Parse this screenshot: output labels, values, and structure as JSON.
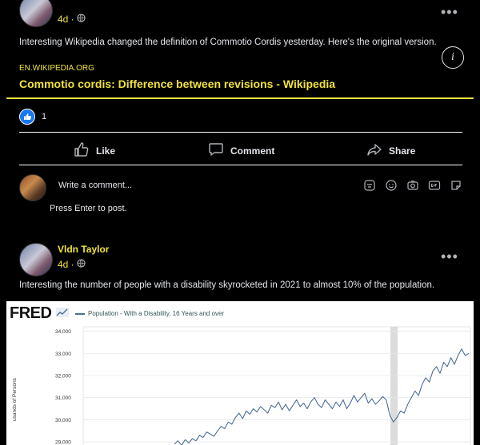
{
  "post1": {
    "time": "4d ·",
    "menu": "•••",
    "text": "Interesting Wikipedia changed the definition of Commotio Cordis yesterday. Here's the original version.",
    "link_domain": "EN.WIKIPEDIA.ORG",
    "link_title": "Commotio cordis: Difference between revisions - Wikipedia",
    "info_glyph": "i",
    "like_count": "1",
    "actions": {
      "like": "Like",
      "comment": "Comment",
      "share": "Share"
    },
    "comment_placeholder": "Write a comment...",
    "comment_hint": "Press Enter to post.",
    "comment_tools": [
      "sticker-icon",
      "emoji-icon",
      "camera-icon",
      "gif-icon",
      "avatar-sticker-icon"
    ]
  },
  "post2": {
    "author": "Vldn Taylor",
    "time": "4d ·",
    "menu": "•••",
    "text": "Interesting the number of people with a disability skyrocketed in 2021 to almost 10% of the population."
  },
  "colors": {
    "accent": "#f1e33a",
    "background": "#000000",
    "like_blue": "#1877f2",
    "chart_line": "#4d6e95"
  },
  "chart_data": {
    "type": "line",
    "logo": "FRED",
    "series": [
      {
        "name": "Population - With a Disability, 16 Years and over",
        "values": [
          28900,
          29050,
          28850,
          29100,
          28950,
          29150,
          29050,
          29300,
          29200,
          29450,
          29350,
          29250,
          29500,
          29700,
          29600,
          29900,
          29800,
          30100,
          30300,
          30050,
          30400,
          30250,
          30500,
          30350,
          30600,
          30450,
          30300,
          30650,
          30550,
          30800,
          30450,
          30700,
          30400,
          30650,
          30900,
          30600,
          30750,
          30500,
          30800,
          31000,
          30700,
          30550,
          30900,
          30700,
          30500,
          30800,
          30600,
          30900,
          30500,
          30750,
          31100,
          30800,
          31000,
          31200,
          30750,
          30950,
          30700,
          30850,
          31050,
          30900,
          30200,
          29900,
          30100,
          30400,
          30300,
          30700,
          31000,
          31300,
          31100,
          31600,
          31900,
          31700,
          32200,
          32400,
          32100,
          32600,
          32400,
          32800,
          32500,
          32900,
          33200,
          32900,
          33000
        ]
      }
    ],
    "ylabel": "usands of Persons",
    "yticks": [
      "34,000",
      "33,000",
      "32,000",
      "31,000",
      "30,000",
      "29,000"
    ],
    "ylim": [
      28500,
      34200
    ],
    "grid": true,
    "recession_shading": true
  }
}
